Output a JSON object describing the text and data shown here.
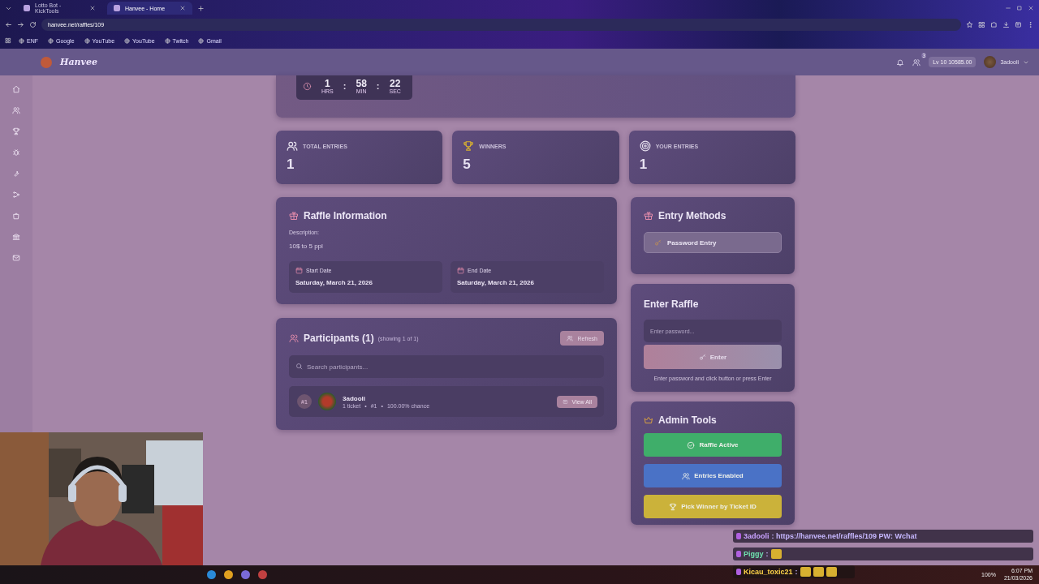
{
  "browser": {
    "tabs": [
      {
        "title": "Lotto Bot - KickTools",
        "selected": false
      },
      {
        "title": "Hanvee - Home",
        "selected": true
      }
    ],
    "url": "hanvee.net/raffles/109",
    "bookmarks": [
      "ENF",
      "Google",
      "YouTube",
      "YouTube",
      "Twitch",
      "Gmail"
    ]
  },
  "header": {
    "logo": "Hanvee",
    "friends_badge": "3",
    "balance": "Lv 10 10585.00",
    "user": "3adooli"
  },
  "timer": [
    {
      "value": "1",
      "unit": "HRS"
    },
    {
      "separator": ":",
      "value": "58",
      "unit": "MIN"
    },
    {
      "separator": ":",
      "value": "22",
      "unit": "SEC"
    }
  ],
  "stats": [
    {
      "kind": "users",
      "label": "TOTAL ENTRIES",
      "value": "1"
    },
    {
      "kind": "trophy",
      "label": "WINNERS",
      "value": "5"
    },
    {
      "kind": "target",
      "label": "YOUR ENTRIES",
      "value": "1"
    }
  ],
  "raffle_info": {
    "title": "Raffle Information",
    "description_label": "Description:",
    "description": "10$ to 5 ppl",
    "dates": [
      {
        "label": "Start Date",
        "value": "Saturday, March 21, 2026"
      },
      {
        "label": "End Date",
        "value": "Saturday, March 21, 2026"
      }
    ]
  },
  "participants": {
    "title": "Participants (1)",
    "note": "(showing 1 of 1)",
    "refresh": "Refresh",
    "search_placeholder": "Search participants...",
    "rows": [
      {
        "rank": "#1",
        "name": "3adooli",
        "details": [
          "1 ticket",
          "•",
          "#1",
          "•",
          "100.00% chance"
        ],
        "action": "View All"
      }
    ]
  },
  "entry_methods": {
    "title": "Entry Methods",
    "methods": [
      "Password Entry"
    ]
  },
  "enter_raffle": {
    "title": "Enter Raffle",
    "placeholder": "Enter password...",
    "button": "Enter",
    "hint": "Enter password and click button or press Enter"
  },
  "admin_tools": {
    "title": "Admin Tools",
    "buttons": [
      {
        "kind": "check",
        "label": "Raffle Active",
        "color": "#3fae6a"
      },
      {
        "kind": "users",
        "label": "Entries Enabled",
        "color": "#4a72c6"
      },
      {
        "kind": "trophy",
        "label": "Pick Winner by Ticket ID",
        "color": "#cbb23a"
      }
    ]
  },
  "chat": [
    {
      "user": "3adooli",
      "color": "#c9a2ff",
      "text": ": https://hanvee.net/raffles/109 PW: Wchat"
    },
    {
      "user": "Piggy",
      "color": "#6fe3b0",
      "text": ":",
      "emotes": [
        {
          "kind": "emote"
        }
      ]
    },
    {
      "user": "Kicau_toxic21",
      "color": "#ffd54a",
      "text": ":",
      "emotes": [
        {
          "kind": "emote"
        },
        {
          "kind": "emote"
        },
        {
          "kind": "emote"
        }
      ]
    }
  ],
  "taskbar": {
    "battery": "100%",
    "time": "6:07 PM",
    "date": "21/03/2026"
  }
}
